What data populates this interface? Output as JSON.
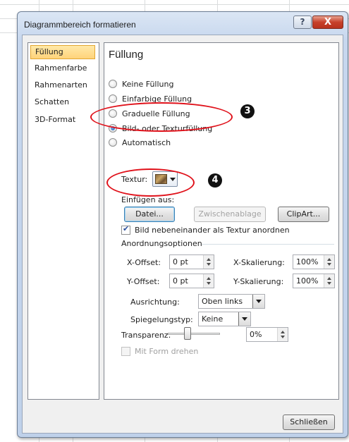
{
  "window": {
    "title": "Diagrammbereich formatieren",
    "help_glyph": "?",
    "close_glyph": "X"
  },
  "sidebar": {
    "items": [
      {
        "label": "Füllung",
        "selected": true
      },
      {
        "label": "Rahmenfarbe",
        "selected": false
      },
      {
        "label": "Rahmenarten",
        "selected": false
      },
      {
        "label": "Schatten",
        "selected": false
      },
      {
        "label": "3D-Format",
        "selected": false
      }
    ]
  },
  "fill": {
    "heading": "Füllung",
    "options": [
      {
        "label": "Keine Füllung",
        "checked": false
      },
      {
        "label": "Einfarbige Füllung",
        "checked": false
      },
      {
        "label": "Graduelle Füllung",
        "checked": false
      },
      {
        "label": "Bild- oder Texturfüllung",
        "checked": true
      },
      {
        "label": "Automatisch",
        "checked": false
      }
    ],
    "texture_label": "Textur:",
    "insert_from_label": "Einfügen aus:",
    "buttons": {
      "file": "Datei...",
      "clipboard": "Zwischenablage",
      "clipart": "ClipArt..."
    },
    "tile_checkbox_label": "Bild nebeneinander als Textur anordnen",
    "tile_checked": true,
    "tiling_group_label": "Anordnungsoptionen",
    "x_offset_label": "X-Offset:",
    "x_offset_value": "0 pt",
    "x_scale_label": "X-Skalierung:",
    "x_scale_value": "100%",
    "y_offset_label": "Y-Offset:",
    "y_offset_value": "0 pt",
    "y_scale_label": "Y-Skalierung:",
    "y_scale_value": "100%",
    "alignment_label": "Ausrichtung:",
    "alignment_value": "Oben links",
    "mirror_label": "Spiegelungstyp:",
    "mirror_value": "Keine",
    "transparency_label": "Transparenz:",
    "transparency_value": "0%",
    "transparency_level": 0,
    "rotate_label": "Mit Form drehen",
    "rotate_checked": false
  },
  "footer": {
    "close_button": "Schließen"
  },
  "annotations": {
    "marker_3": "3",
    "marker_4": "4",
    "color": "#e0121b"
  },
  "colors": {
    "selected_item": "#ffd37a",
    "title_bar": "#c7d7ee",
    "close_button": "#c7412a"
  }
}
